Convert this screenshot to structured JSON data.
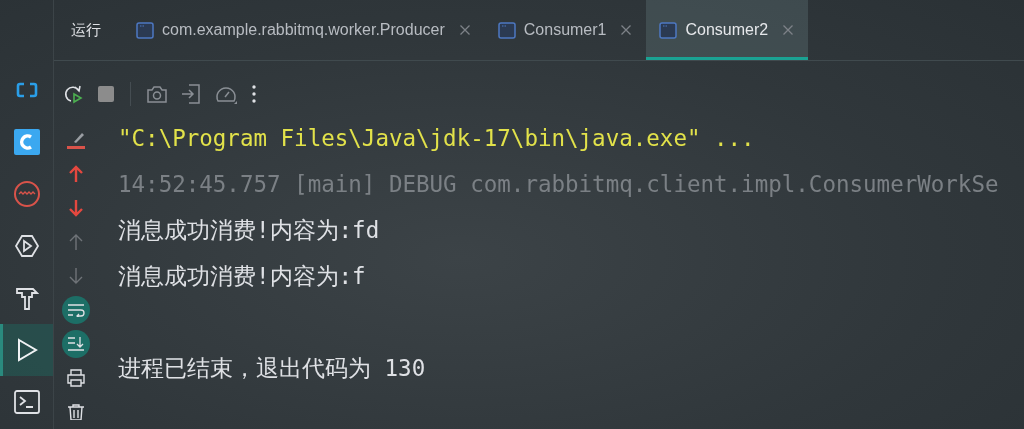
{
  "tool_window": {
    "title": "运行"
  },
  "tabs": [
    {
      "label": "com.example.rabbitmq.worker.Producer",
      "selected": false
    },
    {
      "label": "Consumer1",
      "selected": false
    },
    {
      "label": "Consumer2",
      "selected": true
    }
  ],
  "sidebar": [
    {
      "kind": "bracket",
      "selected": false
    },
    {
      "kind": "c-logo",
      "selected": false
    },
    {
      "kind": "wave",
      "selected": false
    },
    {
      "kind": "services",
      "selected": false
    },
    {
      "kind": "build",
      "selected": false
    },
    {
      "kind": "run",
      "selected": true
    },
    {
      "kind": "terminal",
      "selected": false
    }
  ],
  "toolbar": [
    {
      "kind": "rerun"
    },
    {
      "kind": "stop"
    },
    {
      "kind": "separator"
    },
    {
      "kind": "camera"
    },
    {
      "kind": "import"
    },
    {
      "kind": "gauge"
    },
    {
      "kind": "more"
    }
  ],
  "console_actions": [
    {
      "kind": "clear",
      "on": false
    },
    {
      "kind": "previous-error",
      "on": false
    },
    {
      "kind": "next-error",
      "on": false
    },
    {
      "kind": "previous",
      "on": false
    },
    {
      "kind": "next",
      "on": false
    },
    {
      "kind": "wrap",
      "on": true
    },
    {
      "kind": "scroll-end",
      "on": true
    },
    {
      "kind": "print",
      "on": false
    },
    {
      "kind": "trash",
      "on": false
    }
  ],
  "console": [
    {
      "kind": "command",
      "text": "\"C:\\Program Files\\Java\\jdk-17\\bin\\java.exe\" ..."
    },
    {
      "kind": "log",
      "text": "14:52:45.757 [main] DEBUG com.rabbitmq.client.impl.ConsumerWorkSe"
    },
    {
      "kind": "output",
      "text": "消息成功消费!内容为:fd"
    },
    {
      "kind": "output",
      "text": "消息成功消费!内容为:f"
    },
    {
      "kind": "blank"
    },
    {
      "kind": "output",
      "text": "进程已结束，退出代码为 130"
    }
  ]
}
